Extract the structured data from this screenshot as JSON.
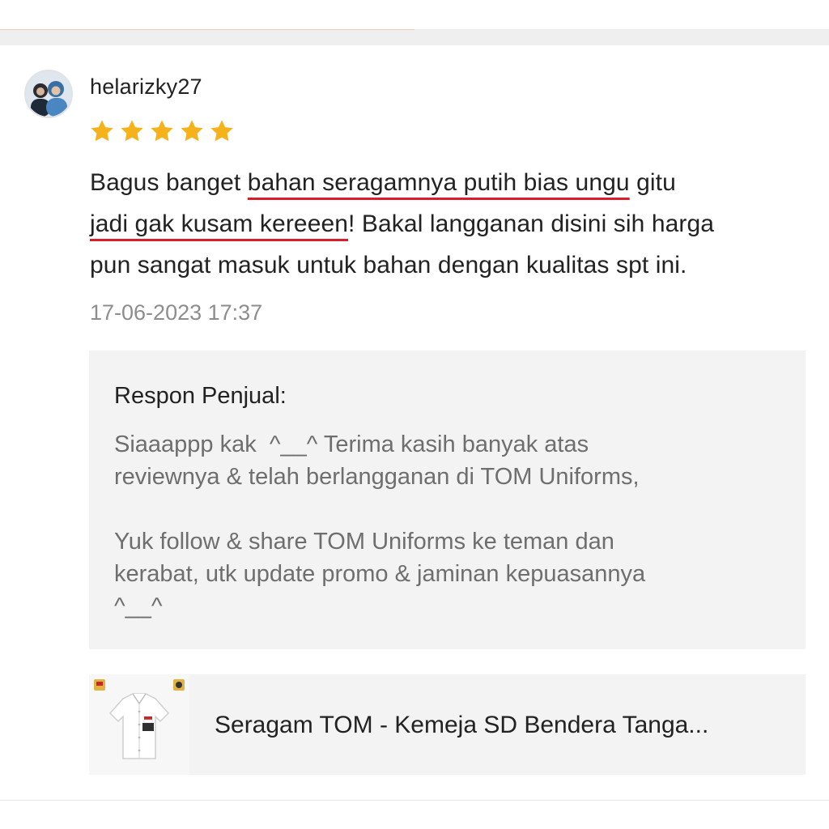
{
  "review": {
    "username": "helarizky27",
    "rating": 5,
    "rating_max": 5,
    "star_color": "#f6b21b",
    "text": {
      "line1_a": "Bagus banget ",
      "line1_hl": "bahan seragamnya putih bias ungu",
      "line1_b": " gitu",
      "line2_hl": "jadi gak kusam kereeen",
      "line2_b": "! Bakal langganan disini sih harga",
      "line3": "pun sangat masuk untuk bahan dengan kualitas spt ini."
    },
    "underline_color": "#d81e2a",
    "timestamp": "17-06-2023 17:37"
  },
  "seller_response": {
    "label": "Respon Penjual:",
    "lines_p1": [
      "Siaaappp kak  ^__^ Terima kasih banyak atas",
      "reviewnya & telah berlangganan di TOM Uniforms,"
    ],
    "lines_p2": [
      "Yuk follow & share TOM Uniforms ke teman dan",
      "kerabat, utk update promo & jaminan kepuasannya",
      "^__^"
    ]
  },
  "product": {
    "title": "Seragam TOM - Kemeja SD Bendera Tanga...",
    "thumbnail_icon": "white-school-shirt-icon"
  }
}
